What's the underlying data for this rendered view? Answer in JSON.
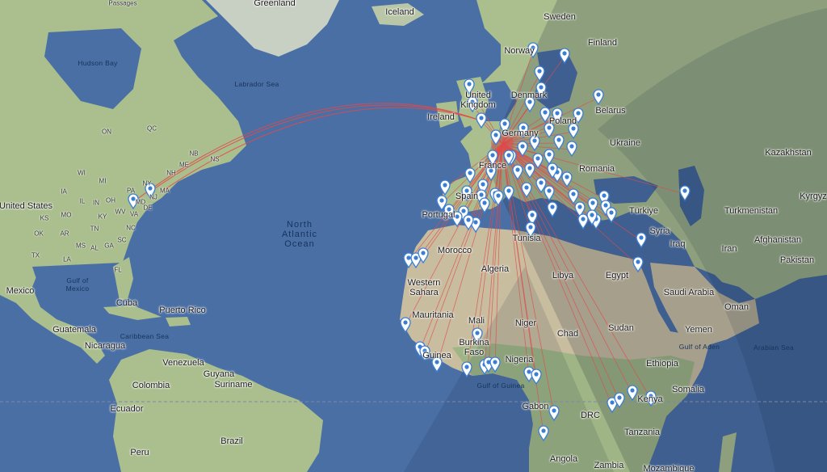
{
  "map": {
    "water_color": "#4a6fa5",
    "land_color": "#aabe8e",
    "desert_color": "#c9bd9f",
    "night_shade_color": "#0b1830",
    "route_color": "#e04a4a",
    "marker_color": "#3b7fd4",
    "labels": {
      "greenland": "Greenland",
      "iceland": "Iceland",
      "passages": "Passages",
      "sweden": "Sweden",
      "finland": "Finland",
      "norway": "Norway",
      "hudson_bay": "Hudson Bay",
      "labrador_sea": "Labrador Sea",
      "united_kingdom": "United Kingdom",
      "denmark": "Denmark",
      "ireland": "Ireland",
      "belarus": "Belarus",
      "poland": "Poland",
      "germany": "Germany",
      "ukraine": "Ukraine",
      "kazakhstan": "Kazakhstan",
      "france": "France",
      "romania": "Romania",
      "kyrgyz": "Kyrgyz",
      "united_states": "United States",
      "north_atlantic_ocean": "North Atlantic Ocean",
      "spain": "Spain",
      "portugal": "Portugal",
      "turkiye": "Türkiye",
      "turkmenistan": "Turkmenistan",
      "tunisia": "Tunisia",
      "syria": "Syria",
      "iraq": "Iraq",
      "afghanistan": "Afghanistan",
      "morocco": "Morocco",
      "pakistan": "Pakistan",
      "iran": "Iran",
      "algeria": "Algeria",
      "libya": "Libya",
      "egypt": "Egypt",
      "mexico": "Mexico",
      "western_sahara": "Western Sahara",
      "gulf_of_mexico": "Gulf of Mexico",
      "saudi_arabia": "Saudi Arabia",
      "oman": "Oman",
      "cuba": "Cuba",
      "puerto_rico": "Puerto Rico",
      "mauritania": "Mauritania",
      "mali": "Mali",
      "niger": "Niger",
      "guatemala": "Guatemala",
      "caribbean_sea": "Caribbean Sea",
      "chad": "Chad",
      "sudan": "Sudan",
      "yemen": "Yemen",
      "nicaragua": "Nicaragua",
      "burkina_faso": "Burkina Faso",
      "guinea": "Guinea",
      "nigeria": "Nigeria",
      "gulf_of_aden": "Gulf of Aden",
      "arabian_sea": "Arabian Sea",
      "venezuela": "Venezuela",
      "guyana": "Guyana",
      "suriname": "Suriname",
      "ethiopia": "Ethiopia",
      "colombia": "Colombia",
      "gulf_of_guinea": "Gulf of Guinea",
      "somalia": "Somalia",
      "ecuador": "Ecuador",
      "gabon": "Gabon",
      "drc": "DRC",
      "kenya": "Kenya",
      "brazil": "Brazil",
      "peru": "Peru",
      "tanzania": "Tanzania",
      "angola": "Angola",
      "zambia": "Zambia",
      "mozambique": "Mozambique",
      "qc": "QC",
      "on": "ON",
      "nb": "NB",
      "ns": "NS",
      "me": "ME",
      "nh": "NH",
      "ma": "MA",
      "ny": "NY",
      "pa": "PA",
      "mi": "MI",
      "wi": "WI",
      "ia": "IA",
      "il": "IL",
      "in": "IN",
      "oh": "OH",
      "wv": "WV",
      "va": "VA",
      "ky": "KY",
      "tn": "TN",
      "nc": "NC",
      "sc": "SC",
      "ga": "GA",
      "al": "AL",
      "ms": "MS",
      "ar": "AR",
      "mo": "MO",
      "ok": "OK",
      "tx": "TX",
      "ks": "KS",
      "la": "LA",
      "fl": "FL",
      "md": "MD",
      "de": "DE",
      "nj": "NJ"
    }
  }
}
